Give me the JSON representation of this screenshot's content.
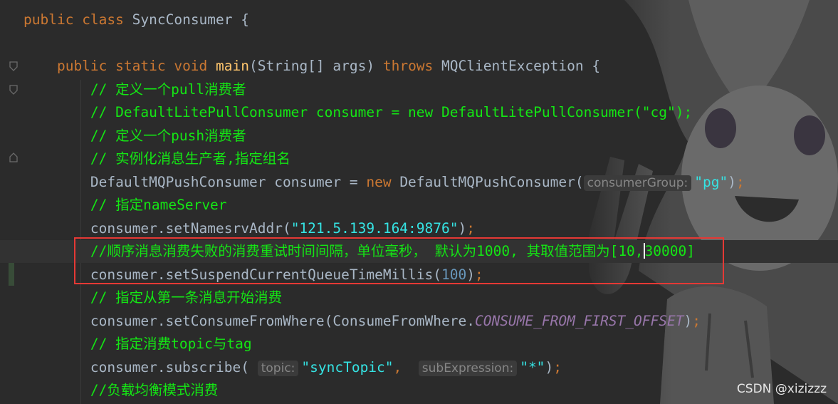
{
  "editor": {
    "lines": [
      {
        "tokens": [
          {
            "t": "public ",
            "c": "kw"
          },
          {
            "t": "class ",
            "c": "kw"
          },
          {
            "t": "SyncConsumer {",
            "c": "txt"
          }
        ]
      },
      {
        "tokens": []
      },
      {
        "tokens": [
          {
            "t": "    public ",
            "c": "kw"
          },
          {
            "t": "static ",
            "c": "kw"
          },
          {
            "t": "void ",
            "c": "kw"
          },
          {
            "t": "main",
            "c": "fn"
          },
          {
            "t": "(String[] args) ",
            "c": "txt"
          },
          {
            "t": "throws ",
            "c": "kw"
          },
          {
            "t": "MQClientException {",
            "c": "txt"
          }
        ]
      },
      {
        "tokens": [
          {
            "t": "        // 定义一个pull消费者",
            "c": "cmt"
          }
        ]
      },
      {
        "tokens": [
          {
            "t": "        // DefaultLitePullConsumer consumer = new DefaultLitePullConsumer(\"cg\");",
            "c": "cmt"
          }
        ]
      },
      {
        "tokens": [
          {
            "t": "        // 定义一个push消费者",
            "c": "cmt"
          }
        ]
      },
      {
        "tokens": [
          {
            "t": "        // 实例化消息生产者,指定组名",
            "c": "cmt"
          }
        ]
      },
      {
        "tokens": [
          {
            "t": "        DefaultMQPushConsumer consumer = ",
            "c": "txt"
          },
          {
            "t": "new ",
            "c": "kw"
          },
          {
            "t": "DefaultMQPushConsumer(",
            "c": "txt"
          },
          {
            "t": "consumerGroup:",
            "c": "hint"
          },
          {
            "t": "\"pg\"",
            "c": "str"
          },
          {
            "t": ")",
            "c": "txt"
          },
          {
            "t": ";",
            "c": "kw"
          }
        ]
      },
      {
        "tokens": [
          {
            "t": "        // 指定nameServer",
            "c": "cmt"
          }
        ]
      },
      {
        "tokens": [
          {
            "t": "        consumer.setNamesrvAddr(",
            "c": "txt"
          },
          {
            "t": "\"121.5.139.164:9876\"",
            "c": "str"
          },
          {
            "t": ")",
            "c": "txt"
          },
          {
            "t": ";",
            "c": "kw"
          }
        ]
      },
      {
        "tokens": [
          {
            "t": "        //顺序消息消费失败的消费重试时间间隔，单位毫秒， 默认为1000, 其取值范围为[10,",
            "c": "cmt"
          },
          {
            "t": "",
            "c": "caret"
          },
          {
            "t": "30000]",
            "c": "cmt"
          }
        ]
      },
      {
        "tokens": [
          {
            "t": "        consumer.setSuspendCurrentQueueTimeMillis(",
            "c": "txt"
          },
          {
            "t": "100",
            "c": "num"
          },
          {
            "t": ")",
            "c": "txt"
          },
          {
            "t": ";",
            "c": "kw"
          }
        ]
      },
      {
        "tokens": [
          {
            "t": "        // 指定从第一条消息开始消费",
            "c": "cmt"
          }
        ]
      },
      {
        "tokens": [
          {
            "t": "        consumer.setConsumeFromWhere(ConsumeFromWhere.",
            "c": "txt"
          },
          {
            "t": "CONSUME_FROM_FIRST_OFFSET",
            "c": "const"
          },
          {
            "t": ")",
            "c": "txt"
          },
          {
            "t": ";",
            "c": "kw"
          }
        ]
      },
      {
        "tokens": [
          {
            "t": "        // 指定消费topic与tag",
            "c": "cmt"
          }
        ]
      },
      {
        "tokens": [
          {
            "t": "        consumer.subscribe( ",
            "c": "txt"
          },
          {
            "t": "topic:",
            "c": "hint"
          },
          {
            "t": "\"syncTopic\"",
            "c": "str"
          },
          {
            "t": ",  ",
            "c": "kw"
          },
          {
            "t": "subExpression:",
            "c": "hint"
          },
          {
            "t": "\"*\"",
            "c": "str"
          },
          {
            "t": ")",
            "c": "txt"
          },
          {
            "t": ";",
            "c": "kw"
          }
        ]
      },
      {
        "tokens": [
          {
            "t": "        //负载均衡模式消费",
            "c": "cmt"
          }
        ]
      }
    ]
  },
  "highlighted_line": 10,
  "watermark": "CSDN @xizizzz",
  "colors": {
    "keyword": "#cc7832",
    "function": "#ffc66d",
    "comment": "#14e614",
    "string": "#35e3e3",
    "number": "#6897bb",
    "constant": "#9876aa",
    "text": "#a9b7c6",
    "annotation_box": "#e53935"
  }
}
